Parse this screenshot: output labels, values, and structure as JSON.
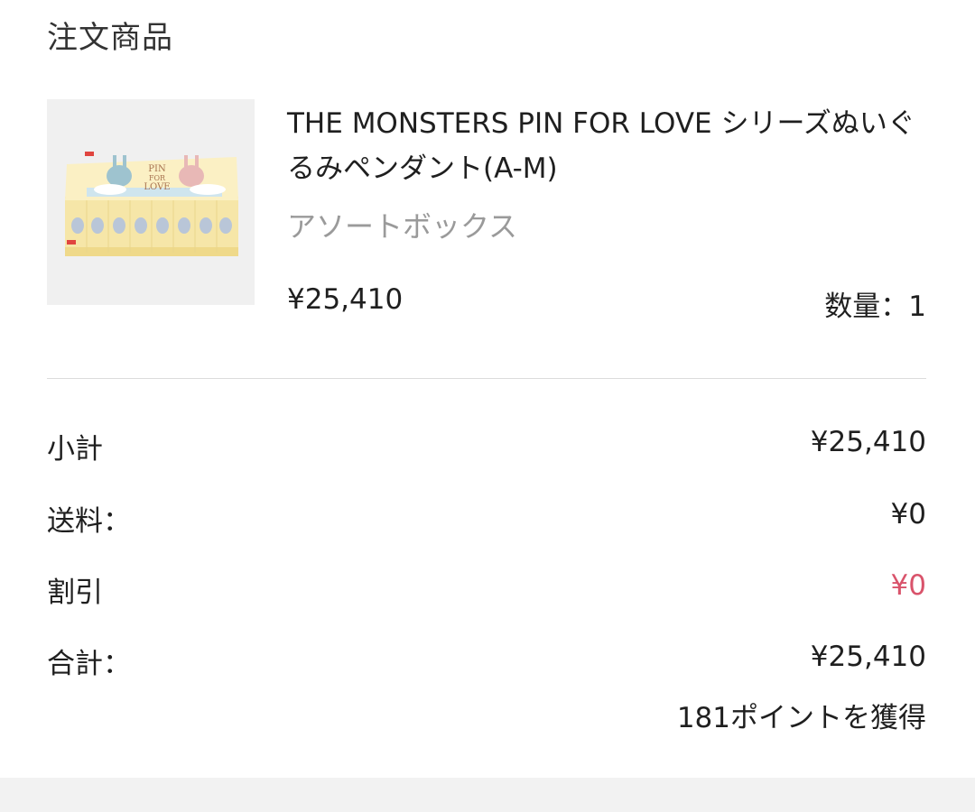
{
  "section": {
    "title": "注文商品"
  },
  "product": {
    "image_alt": "product-box-image",
    "box_text": "PIN FOR LOVE",
    "name": "THE MONSTERS PIN FOR LOVE シリーズぬいぐるみペンダント(A-M)",
    "variant": "アソートボックス",
    "price": "¥25,410",
    "quantity_label": "数量：1"
  },
  "summary": {
    "subtotal_label": "小計",
    "subtotal_value": "¥25,410",
    "shipping_label": "送料：",
    "shipping_value": "¥0",
    "discount_label": "割引",
    "discount_value": "¥0",
    "total_label": "合計：",
    "total_value": "¥25,410",
    "points_text": "181ポイントを獲得"
  },
  "colors": {
    "discount": "#d9536b",
    "divider": "#dcdcdc",
    "muted_text": "#9a9a9a"
  }
}
